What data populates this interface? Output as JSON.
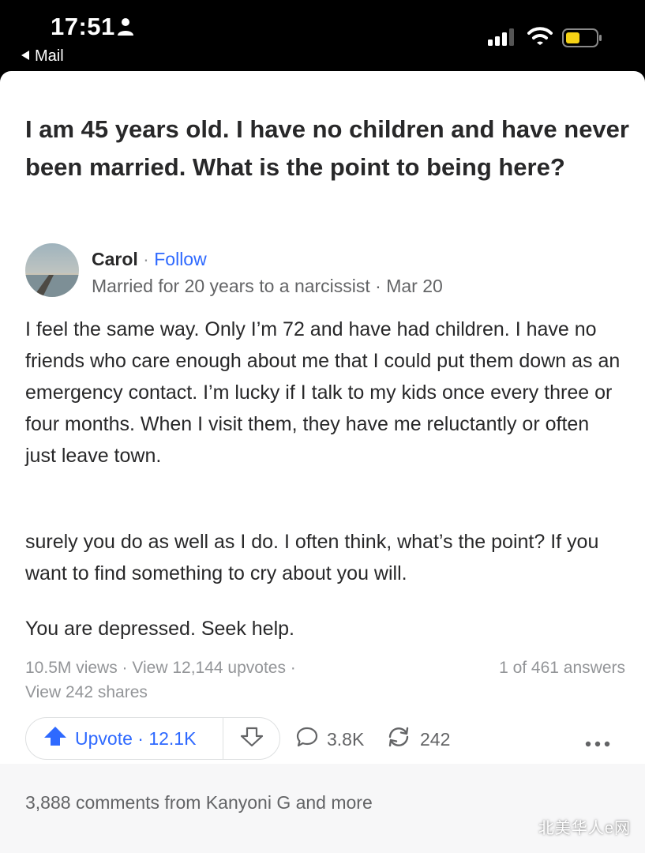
{
  "status_bar": {
    "time": "17:51",
    "back_label": "Mail",
    "icons": [
      "person-icon",
      "signal-icon",
      "wifi-icon",
      "battery-icon"
    ],
    "battery_color": "#f5d215"
  },
  "question": {
    "title": "I am 45 years old. I have no children and have never been married. What is the point to being here?"
  },
  "answer": {
    "author": {
      "name": "Carol",
      "separator": " · ",
      "follow_label": "Follow",
      "credential": "Married for 20 years to a narcissist · Mar 20"
    },
    "paragraphs": [
      "I feel the same way. Only I’m 72 and have had children. I have no friends who care enough about me that I could put them down as an emergency contact. I’m lucky if I talk to my kids once every three or four months. When I visit them, they have me reluctantly or often just leave town.",
      "surely you do as well as I do. I often think, what’s the point? If you want to find something to cry about you will.",
      "You are depressed. Seek help."
    ],
    "stats": {
      "views": "10.5M views · View 12,144 upvotes ·",
      "shares": "View 242 shares",
      "position": "1 of 461 answers"
    },
    "actions": {
      "upvote_label": "Upvote · 12.1K",
      "comments_count": "3.8K",
      "shares_count": "242"
    }
  },
  "comments_bar": {
    "text": "3,888 comments from Kanyoni G and more"
  },
  "watermark": "北美华人e网",
  "colors": {
    "accent": "#2e69ff",
    "text": "#282829",
    "muted": "#939598",
    "secondary": "#636466"
  }
}
